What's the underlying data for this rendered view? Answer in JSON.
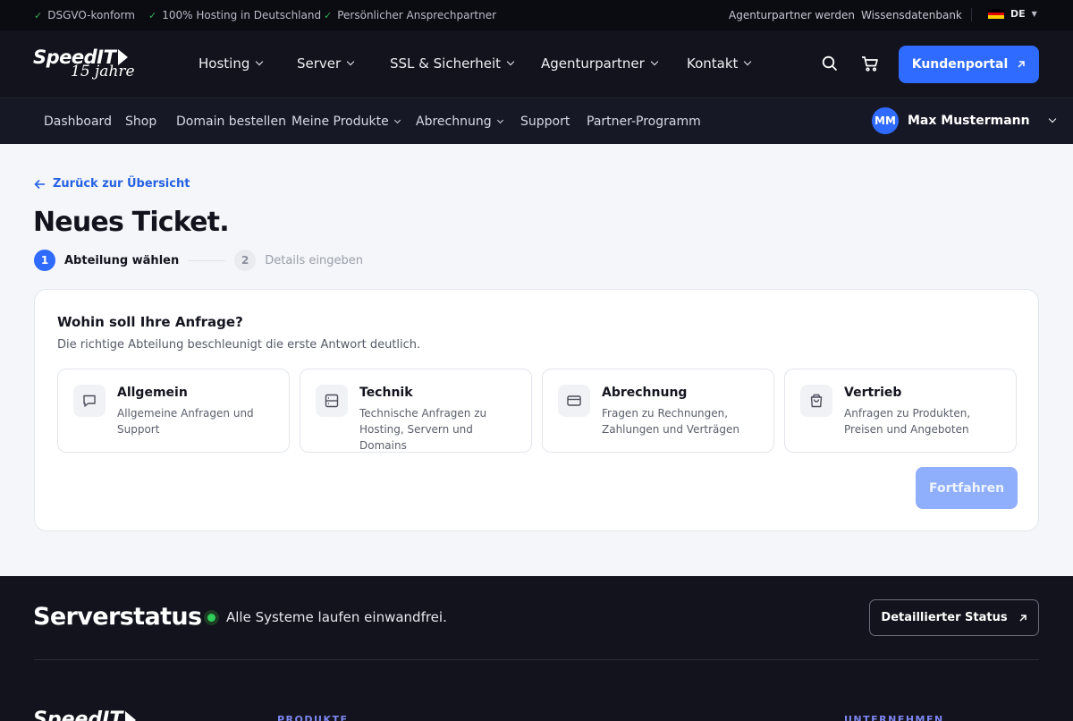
{
  "topbar": {
    "usps": [
      "DSGVO-konform",
      "100% Hosting in Deutschland",
      "Persönlicher Ansprechpartner"
    ],
    "links": [
      "Agenturpartner werden",
      "Wissensdatenbank"
    ],
    "language": "DE"
  },
  "header": {
    "logo_text": "SpeedIT",
    "logo_sub": "15 jahre",
    "nav": [
      "Hosting",
      "Server",
      "SSL & Sicherheit",
      "Agenturpartner",
      "Kontakt"
    ],
    "cta_label": "Kundenportal"
  },
  "subnav": {
    "items": [
      "Dashboard",
      "Shop",
      "Domain bestellen",
      "Meine Produkte",
      "Abrechnung",
      "Support",
      "Partner-Programm"
    ],
    "user_initials": "MM",
    "user_name": "Max Mustermann"
  },
  "main": {
    "back_label": "Zurück zur Übersicht",
    "title": "Neues Ticket.",
    "steps": [
      {
        "num": "1",
        "label": "Abteilung wählen"
      },
      {
        "num": "2",
        "label": "Details eingeben"
      }
    ],
    "card": {
      "title": "Wohin soll Ihre Anfrage?",
      "subtitle": "Die richtige Abteilung beschleunigt die erste Antwort deutlich.",
      "departments": [
        {
          "name": "Allgemein",
          "desc": "Allgemeine Anfragen und Support",
          "icon": "chat-icon"
        },
        {
          "name": "Technik",
          "desc": "Technische Anfragen zu Hosting, Servern und Domains",
          "icon": "server-icon"
        },
        {
          "name": "Abrechnung",
          "desc": "Fragen zu Rechnungen, Zahlungen und Verträgen",
          "icon": "credit-card-icon"
        },
        {
          "name": "Vertrieb",
          "desc": "Anfragen zu Produkten, Preisen und Angeboten",
          "icon": "shopping-bag-icon"
        }
      ],
      "continue_label": "Fortfahren"
    }
  },
  "footer": {
    "status_title": "Serverstatus",
    "status_text": "Alle Systeme laufen einwandfrei.",
    "status_button": "Detaillierter Status",
    "logo_text": "SpeedIT",
    "col_products": "PRODUKTE",
    "col_company": "UNTERNEHMEN"
  },
  "colors": {
    "accent": "#2f6bff",
    "dark_bg": "#12131c",
    "status_ok": "#2fcf5a"
  }
}
